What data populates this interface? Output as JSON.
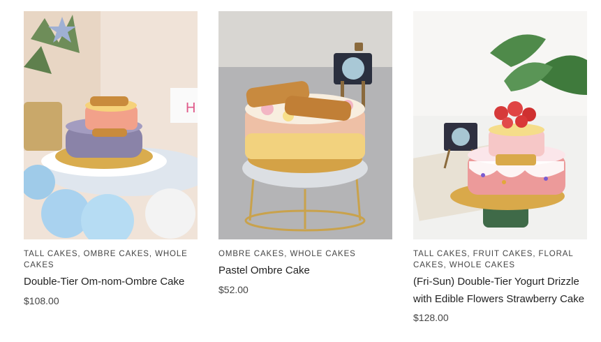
{
  "products": [
    {
      "image_alt": "Double-Tier Om-nom-Ombre Cake",
      "categories": [
        "TALL CAKES",
        "OMBRE CAKES",
        "WHOLE CAKES"
      ],
      "title": "Double-Tier Om-nom-Ombre Cake",
      "price": "$108.00"
    },
    {
      "image_alt": "Pastel Ombre Cake",
      "categories": [
        "OMBRE CAKES",
        "WHOLE CAKES"
      ],
      "title": "Pastel Ombre Cake",
      "price": "$52.00"
    },
    {
      "image_alt": "(Fri-Sun) Double-Tier Yogurt Drizzle with Edible Flowers Strawberry Cake",
      "categories": [
        "TALL CAKES",
        "FRUIT CAKES",
        "FLORAL CAKES",
        "WHOLE CAKES"
      ],
      "title": "(Fri-Sun) Double-Tier Yogurt Drizzle with Edible Flowers Strawberry Cake",
      "price": "$128.00"
    }
  ],
  "separator": ", "
}
